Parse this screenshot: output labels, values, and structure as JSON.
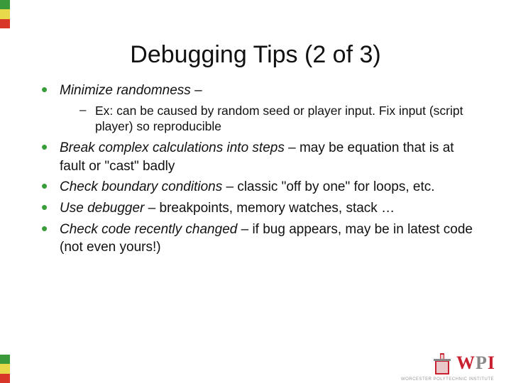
{
  "title": "Debugging Tips (2 of 3)",
  "bullets": [
    {
      "em": "Minimize randomness",
      "rest": " –",
      "sub": "Ex: can be caused by random seed or player input. Fix input (script player) so reproducible"
    },
    {
      "em": "Break complex calculations into steps",
      "rest": " – may be equation that is at fault or \"cast\" badly"
    },
    {
      "em": "Check boundary conditions",
      "rest": " – classic \"off by one\" for loops, etc."
    },
    {
      "em": "Use debugger",
      "rest": " – breakpoints, memory watches, stack …"
    },
    {
      "em": "Check code recently changed",
      "rest": " – if bug appears, may be in latest code (not even yours!)"
    }
  ],
  "stripe_colors": [
    "#3a9a3a",
    "#e8d94a",
    "#d9362a",
    "#3a9a3a",
    "#e8d94a",
    "#d9362a"
  ],
  "logo": {
    "letters": [
      "W",
      "P",
      "I"
    ],
    "subtitle": "WORCESTER POLYTECHNIC INSTITUTE"
  }
}
